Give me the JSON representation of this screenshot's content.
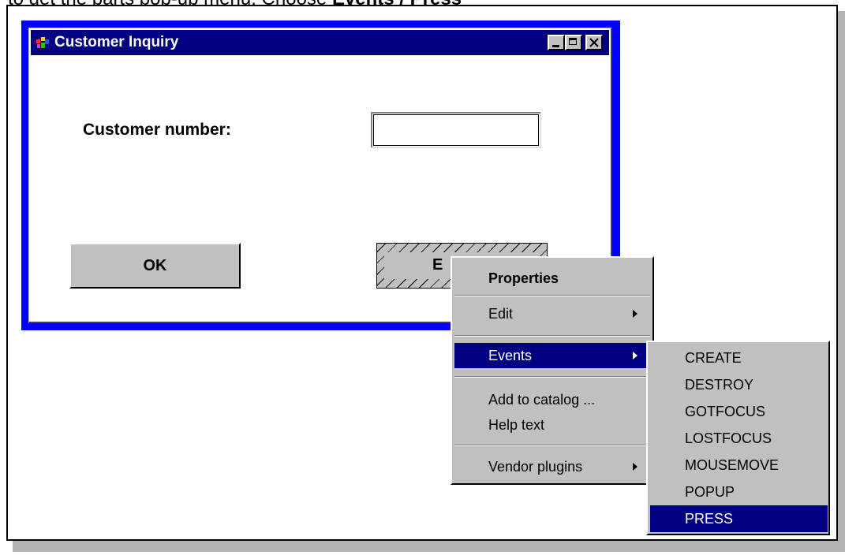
{
  "caption": {
    "prefix": "to get the parts pop-up menu. Choose ",
    "emphasis": "Events / Press"
  },
  "window": {
    "title": "Customer Inquiry",
    "customer_label": "Customer number:",
    "customer_value": "",
    "ok_label": "OK",
    "exit_label": "E"
  },
  "menu": {
    "items": [
      {
        "label": "Properties",
        "bold": true
      },
      {
        "label": "Edit",
        "submenu": true
      },
      {
        "label": "Events",
        "submenu": true,
        "selected": true
      },
      {
        "label": "Add to catalog ..."
      },
      {
        "label": "Help text"
      },
      {
        "label": "Vendor plugins",
        "submenu": true
      }
    ]
  },
  "submenu": {
    "items": [
      "CREATE",
      "DESTROY",
      "GOTFOCUS",
      "LOSTFOCUS",
      "MOUSEMOVE",
      "POPUP",
      "PRESS"
    ],
    "selected": "PRESS"
  },
  "colors": {
    "window_border": "#0000ff",
    "titlebar": "#000080",
    "menu_bg": "#c0c0c0",
    "highlight": "#000080"
  },
  "icons": [
    "app-icon",
    "minimize-icon",
    "maximize-icon",
    "close-icon",
    "submenu-arrow-icon"
  ]
}
